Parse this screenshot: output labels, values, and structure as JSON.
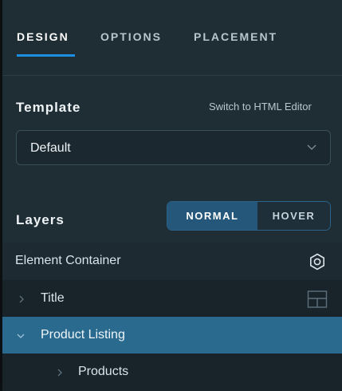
{
  "tabs": [
    {
      "label": "DESIGN",
      "active": true
    },
    {
      "label": "OPTIONS",
      "active": false
    },
    {
      "label": "PLACEMENT",
      "active": false
    }
  ],
  "template": {
    "title": "Template",
    "switch_link": "Switch to HTML Editor",
    "selected": "Default"
  },
  "layers": {
    "title": "Layers",
    "state_toggle": {
      "normal": "NORMAL",
      "hover": "HOVER",
      "selected": "NORMAL"
    },
    "items": [
      {
        "label": "Element Container",
        "icon": "settings-target-icon"
      },
      {
        "label": "Title",
        "expanded": false,
        "icon": "layout-grid-icon"
      },
      {
        "label": "Product Listing",
        "expanded": true,
        "selected": true
      },
      {
        "label": "Products",
        "expanded": false
      }
    ]
  },
  "colors": {
    "accent": "#1c8fe3",
    "selected_row": "#2a6a8f",
    "panel_bg": "#1f2d35"
  }
}
